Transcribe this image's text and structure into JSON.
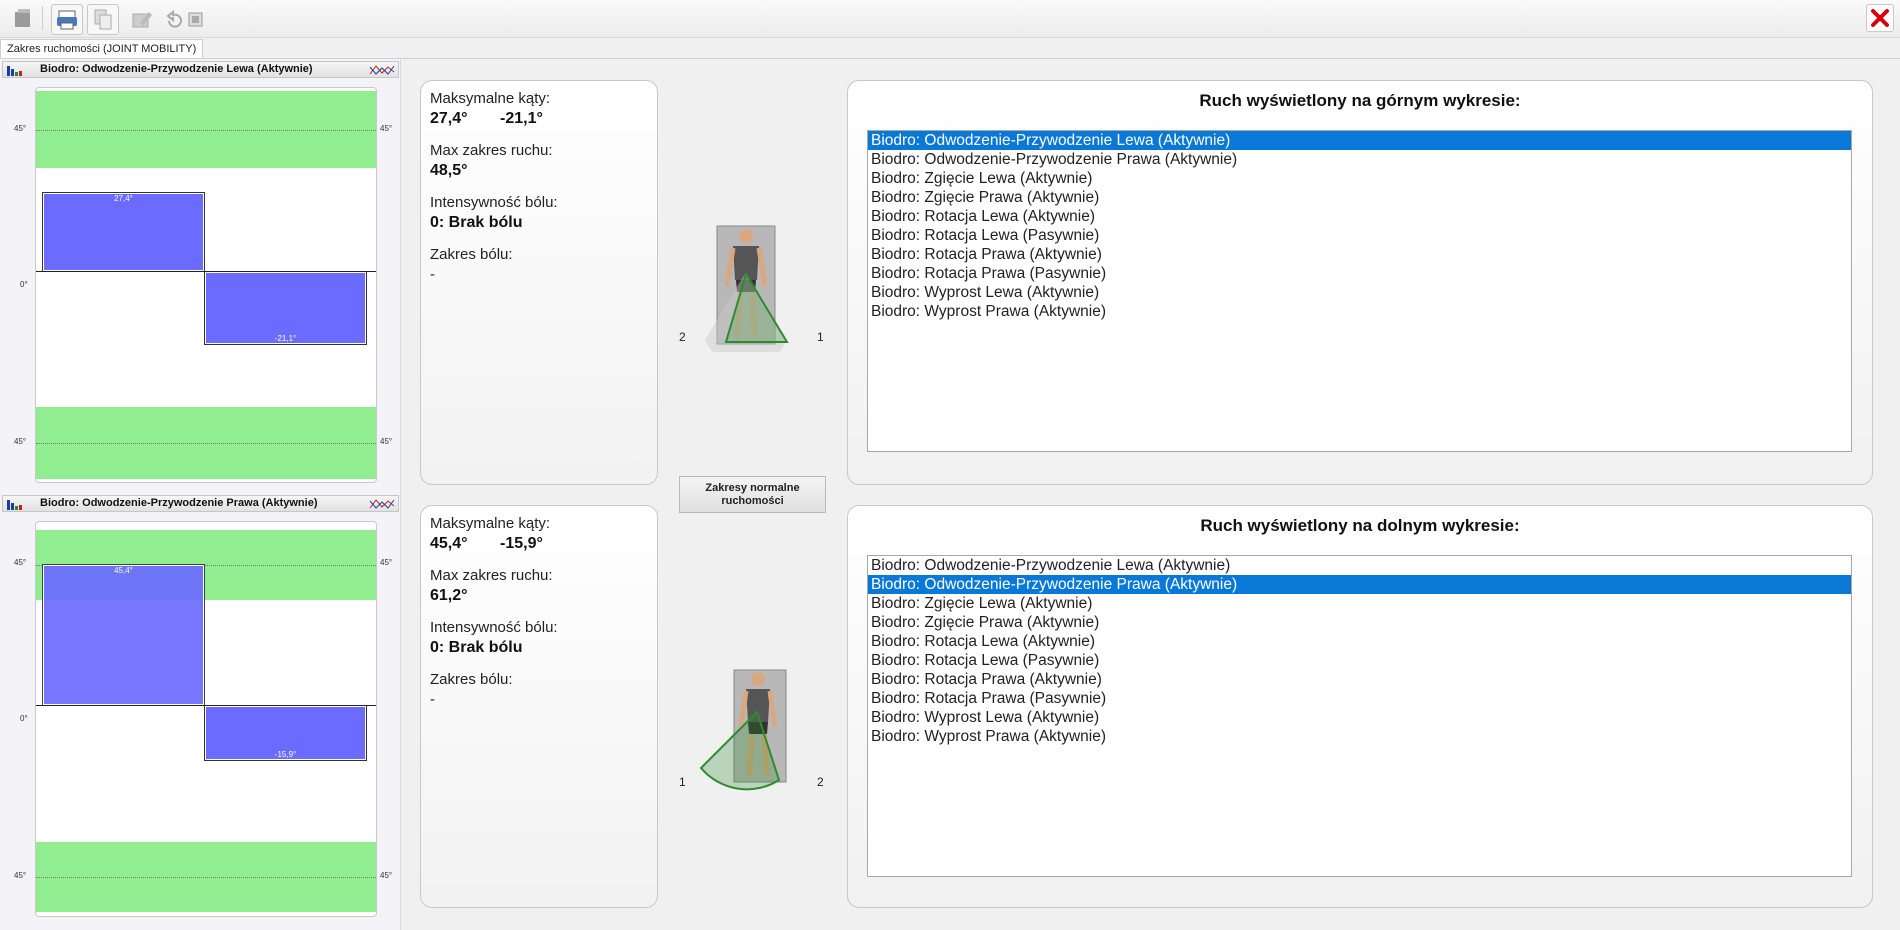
{
  "window": {
    "tab_label": "Zakres ruchomości (JOINT MOBILITY)"
  },
  "toolbar": {
    "icons": [
      "module-icon",
      "print-icon",
      "copy-icon",
      "edit-icon",
      "undo-icon",
      "export-icon"
    ],
    "close_icon": "close-icon",
    "close_color": "#d9000d"
  },
  "upper_chart": {
    "title": "Biodro: Odwodzenie-Przywodzenie Lewa (Aktywnie)",
    "axis": {
      "top": "45°",
      "zero": "0°",
      "bottom": "45°"
    },
    "bars": [
      {
        "label": "27,4°",
        "value": 27.4
      },
      {
        "label": "-21,1°",
        "value": -21.1
      }
    ]
  },
  "lower_chart": {
    "title": "Biodro: Odwodzenie-Przywodzenie Prawa (Aktywnie)",
    "axis": {
      "top": "45°",
      "zero": "0°",
      "bottom": "45°"
    },
    "bars": [
      {
        "label": "45,4°",
        "value": 45.4
      },
      {
        "label": "-15,9°",
        "value": -15.9
      }
    ]
  },
  "upper_info": {
    "max_angles_label": "Maksymalne kąty:",
    "angle1": "27,4°",
    "angle2": "-21,1°",
    "range_label": "Max zakres ruchu:",
    "range_value": "48,5°",
    "pain_label": "Intensywność bólu:",
    "pain_value": "0: Brak bólu",
    "pain_range_label": "Zakres bólu:",
    "pain_range_value": "-"
  },
  "lower_info": {
    "max_angles_label": "Maksymalne kąty:",
    "angle1": "45,4°",
    "angle2": "-15,9°",
    "range_label": "Max zakres ruchu:",
    "range_value": "61,2°",
    "pain_label": "Intensywność bólu:",
    "pain_value": "0: Brak bólu",
    "pain_range_label": "Zakres bólu:",
    "pain_range_value": "-"
  },
  "upper_figure": {
    "left_label": "2",
    "right_label": "1"
  },
  "lower_figure": {
    "left_label": "1",
    "right_label": "2"
  },
  "normal_ranges_button": "Zakresy normalne ruchomości",
  "upper_list": {
    "title": "Ruch wyświetlony na górnym wykresie:",
    "selected_index": 0,
    "items": [
      "Biodro: Odwodzenie-Przywodzenie Lewa (Aktywnie)",
      "Biodro: Odwodzenie-Przywodzenie Prawa (Aktywnie)",
      "Biodro: Zgięcie Lewa (Aktywnie)",
      "Biodro: Zgięcie Prawa (Aktywnie)",
      "Biodro: Rotacja Lewa (Aktywnie)",
      "Biodro: Rotacja Lewa (Pasywnie)",
      "Biodro: Rotacja Prawa (Aktywnie)",
      "Biodro: Rotacja Prawa (Pasywnie)",
      "Biodro: Wyprost Lewa (Aktywnie)",
      "Biodro: Wyprost Prawa (Aktywnie)"
    ]
  },
  "lower_list": {
    "title": "Ruch wyświetlony na dolnym wykresie:",
    "selected_index": 1,
    "items": [
      "Biodro: Odwodzenie-Przywodzenie Lewa (Aktywnie)",
      "Biodro: Odwodzenie-Przywodzenie Prawa (Aktywnie)",
      "Biodro: Zgięcie Lewa (Aktywnie)",
      "Biodro: Zgięcie Prawa (Aktywnie)",
      "Biodro: Rotacja Lewa (Aktywnie)",
      "Biodro: Rotacja Lewa (Pasywnie)",
      "Biodro: Rotacja Prawa (Aktywnie)",
      "Biodro: Rotacja Prawa (Pasywnie)",
      "Biodro: Wyprost Lewa (Aktywnie)",
      "Biodro: Wyprost Prawa (Aktywnie)"
    ]
  },
  "colors": {
    "normal_zone": "#90ee90",
    "bar": "#6b6bff",
    "selection": "#0a78d7",
    "sector": "#2e8b2e"
  }
}
